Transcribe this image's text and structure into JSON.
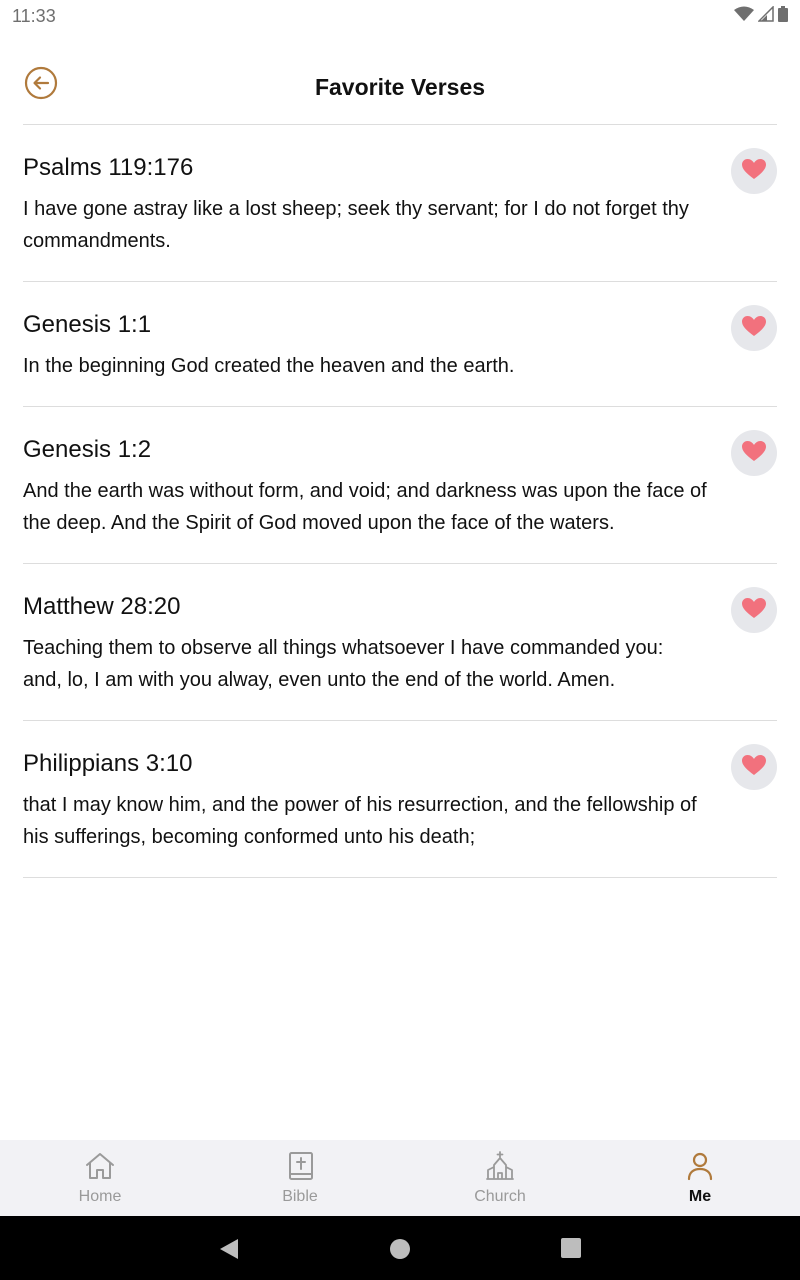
{
  "status_bar": {
    "time": "11:33",
    "icons": [
      "wifi-icon",
      "signal-icon",
      "battery-icon"
    ]
  },
  "header": {
    "title": "Favorite Verses",
    "back_icon": "back-arrow-circle-icon"
  },
  "verses": [
    {
      "reference": "Psalms 119:176",
      "text": "I have gone astray like a lost sheep; seek thy servant; for I do not forget thy commandments.",
      "favorite_icon": "heart-icon"
    },
    {
      "reference": "Genesis 1:1",
      "text": "In the beginning God created the heaven and the earth.",
      "favorite_icon": "heart-icon"
    },
    {
      "reference": "Genesis 1:2",
      "text": "And the earth was without form, and void; and darkness was upon the face of the deep. And the Spirit of God moved upon the face of the waters.",
      "favorite_icon": "heart-icon"
    },
    {
      "reference": "Matthew 28:20",
      "text": "Teaching them to observe all things whatsoever I have commanded you: and, lo, I am with you alway, even unto the end of the world. Amen.",
      "favorite_icon": "heart-icon"
    },
    {
      "reference": "Philippians 3:10",
      "text": "that I may know him, and the power of his resurrection, and the fellowship of his sufferings, becoming conformed unto his death;",
      "favorite_icon": "heart-icon"
    }
  ],
  "bottom_nav": {
    "items": [
      {
        "label": "Home",
        "icon": "home-icon",
        "active": false
      },
      {
        "label": "Bible",
        "icon": "bible-icon",
        "active": false
      },
      {
        "label": "Church",
        "icon": "church-icon",
        "active": false
      },
      {
        "label": "Me",
        "icon": "person-icon",
        "active": true
      }
    ]
  },
  "colors": {
    "accent": "#b07a3c",
    "heart": "#f2717d",
    "heart_bg": "#e6e7eb",
    "nav_bg": "#f2f2f5",
    "divider": "#dddddd"
  }
}
